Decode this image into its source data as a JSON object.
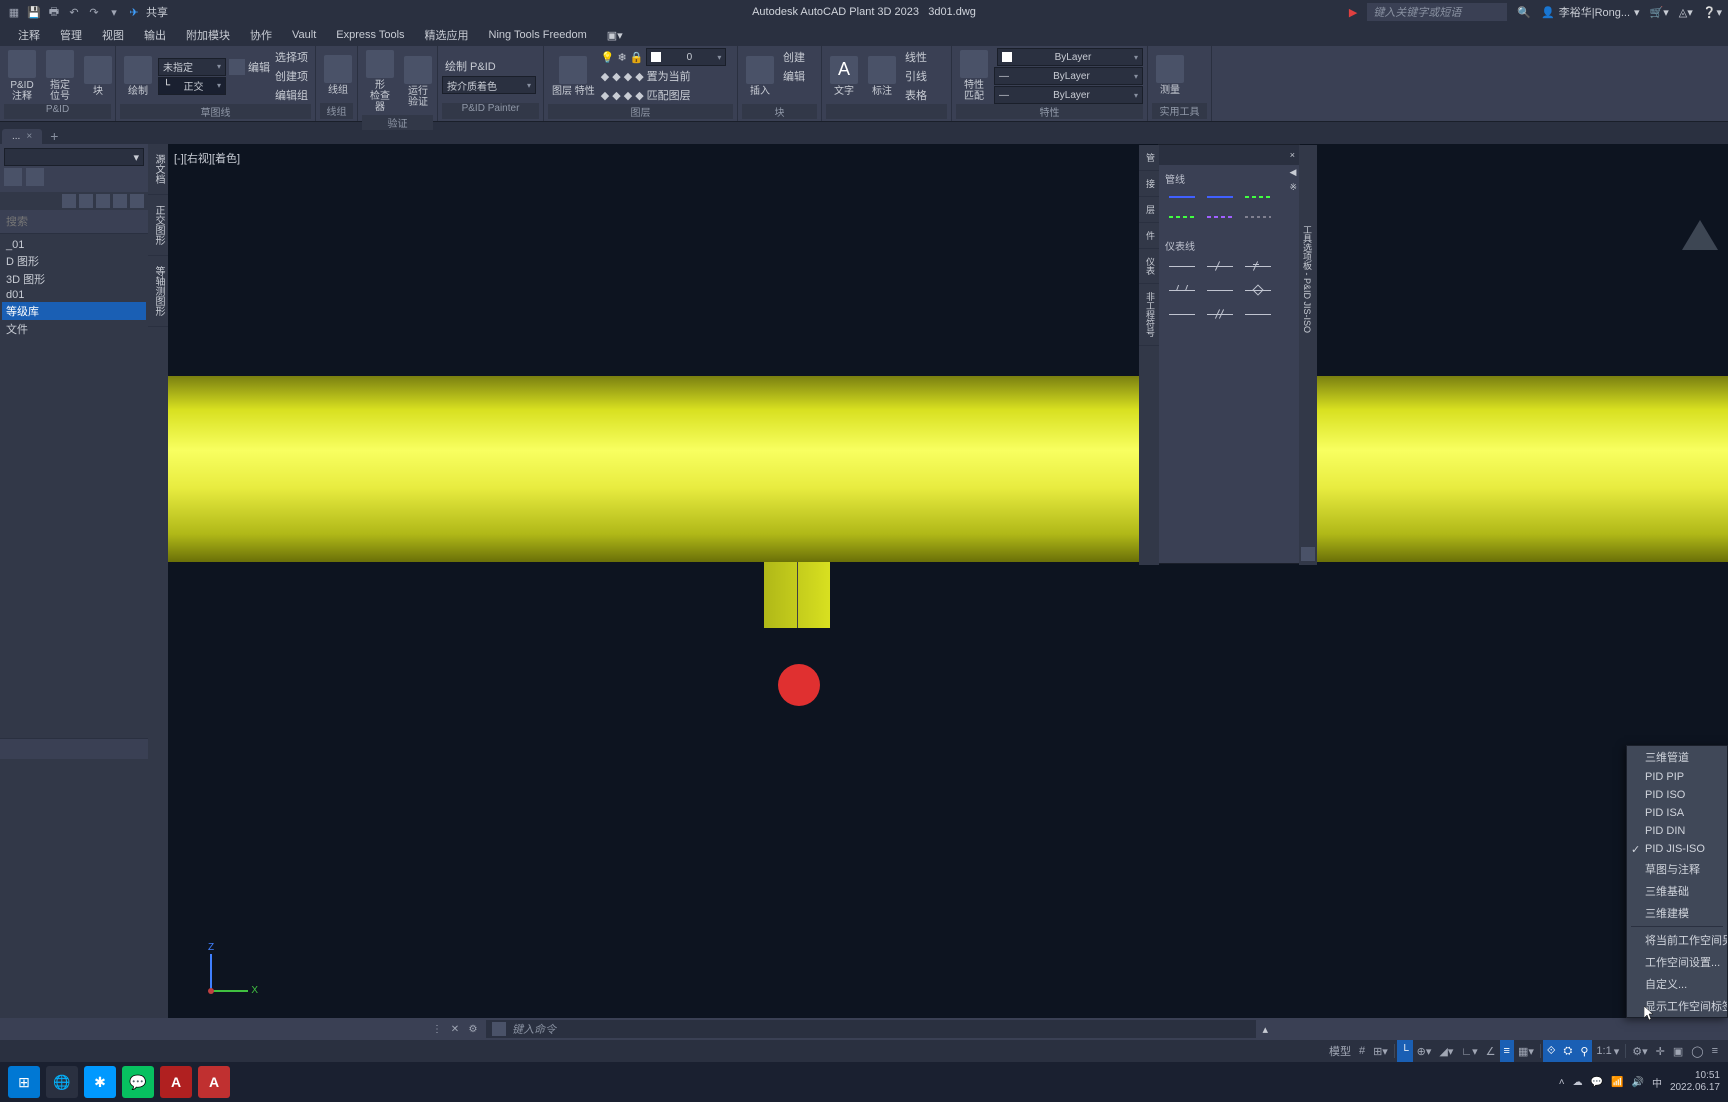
{
  "titlebar": {
    "share": "共享",
    "app": "Autodesk AutoCAD Plant 3D 2023",
    "file": "3d01.dwg",
    "search_ph": "键入关键字或短语",
    "user": "李裕华|Rong..."
  },
  "menubar": [
    "注释",
    "管理",
    "视图",
    "输出",
    "附加模块",
    "协作",
    "Vault",
    "Express Tools",
    "精选应用",
    "Ning Tools Freedom"
  ],
  "ribbon": {
    "pid_note": "P&ID\n注释",
    "tag_no": "指定\n位号",
    "block": "块",
    "panel_pid": "P&ID",
    "draw": "绘制",
    "unspecified": "未指定",
    "edit": "编辑",
    "ortho": "正交",
    "select_item": "选择项",
    "create_item": "创建项",
    "edit_group": "编辑组",
    "panel_sketch": "草图线",
    "line_group": "线组",
    "line": "线",
    "xing": "形",
    "checker": "检查器",
    "run": "运行",
    "validate": "验证",
    "panel_validate": "验证",
    "draw_pid": "绘制 P&ID",
    "color_by": "按介质着色",
    "panel_painter": "P&ID Painter",
    "layer_prop": "图层\n特性",
    "zero": "0",
    "make_current": "置为当前",
    "match_layer": "匹配图层",
    "panel_layer": "图层",
    "insert": "插入",
    "create": "创建",
    "edit2": "编辑",
    "panel_block": "块",
    "text": "文字",
    "annotate": "标注",
    "linear": "线性",
    "leader": "引线",
    "table": "表格",
    "prop": "特性",
    "match": "匹配",
    "bylayer": "ByLayer",
    "panel_prop": "特性",
    "measure": "测量",
    "panel_util": "实用工具"
  },
  "doctab": {
    "name": "...",
    "x": "×",
    "add": "+"
  },
  "sidebar": {
    "search_ph": "搜索",
    "items": [
      "_01",
      "D 图形",
      "3D 图形",
      "d01",
      "等级库",
      "文件"
    ],
    "selected": 4
  },
  "vtabs": [
    "源文档",
    "正交图形",
    "等轴测图形"
  ],
  "viewport": {
    "label": "[-][右视][着色]",
    "z": "Z",
    "x": "X"
  },
  "palette": {
    "title": "",
    "close": "×",
    "pipelines": "管线",
    "instr_lines": "仪表线",
    "side": "工具选项板 - P&ID JIS-ISO",
    "vtabs": [
      "管",
      "接",
      "层",
      "件",
      "仪表",
      "非工程符号"
    ]
  },
  "ctxmenu": {
    "items": [
      "三维管道",
      "PID PIP",
      "PID ISO",
      "PID ISA",
      "PID DIN",
      "PID JIS-ISO",
      "草图与注释",
      "三维基础",
      "三维建模"
    ],
    "checked": 5,
    "items2": [
      "将当前工作空间另存",
      "工作空间设置...",
      "自定义...",
      "显示工作空间标签"
    ]
  },
  "cmdline": {
    "ph": "键入命令"
  },
  "statusbar": {
    "model": "模型",
    "scale": "1:1"
  },
  "taskbar": {
    "time": "10:51",
    "date": "2022.06.17",
    "ime": "中"
  }
}
